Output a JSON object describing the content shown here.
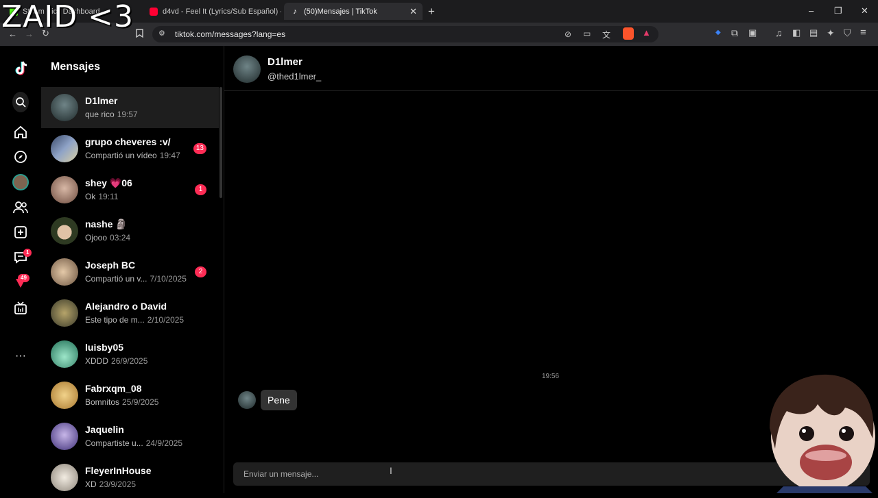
{
  "overlay_text": "ZAID <3",
  "browser": {
    "tabs": [
      {
        "title": "Steam Kick Dashboard",
        "favicon_color": "#53fc18",
        "active": false
      },
      {
        "title": "d4vd - Feel It (Lyrics/Sub Español) - Y",
        "favicon_color": "#ff0033",
        "active": false
      },
      {
        "title": "(50)Mensajes | TikTok",
        "favicon_color": "#111111",
        "active": true
      }
    ],
    "url": "tiktok.com/messages?lang=es",
    "window_controls": {
      "minimize": "–",
      "restore": "❐",
      "close": "✕"
    },
    "new_tab": "+"
  },
  "rail": {
    "notifications_badge": "1",
    "activity_badge": "49"
  },
  "messages": {
    "title": "Mensajes",
    "conversations": [
      {
        "name": "D1lmer",
        "preview": "que rico",
        "time": "19:57",
        "unread": "",
        "avatar": "#3b4d4f",
        "selected": true
      },
      {
        "name": "grupo cheveres :v/",
        "preview": "Compartió un vídeo",
        "time": "19:47",
        "unread": "13",
        "avatar": "#7a8aa8",
        "selected": false
      },
      {
        "name": "shey 💗06",
        "preview": "Ok",
        "time": "19:11",
        "unread": "1",
        "avatar": "#9b7f74",
        "selected": false
      },
      {
        "name": "nashe 🗿",
        "preview": "Ojooo",
        "time": "03:24",
        "unread": "",
        "avatar": "#4e5c3c",
        "selected": false
      },
      {
        "name": "Joseph BC",
        "preview": "Compartió un v...",
        "time": "7/10/2025",
        "unread": "2",
        "avatar": "#8a7562",
        "selected": false
      },
      {
        "name": "Alejandro o David",
        "preview": "Este tipo de m...",
        "time": "2/10/2025",
        "unread": "",
        "avatar": "#5d5a44",
        "selected": false
      },
      {
        "name": "luisby05",
        "preview": "XDDD",
        "time": "26/9/2025",
        "unread": "",
        "avatar": "#2f8f6f",
        "selected": false
      },
      {
        "name": "Fabrxqm_08",
        "preview": "Bomnitos",
        "time": "25/9/2025",
        "unread": "",
        "avatar": "#c79a42",
        "selected": false
      },
      {
        "name": "Jaquelin",
        "preview": "Compartiste u...",
        "time": "24/9/2025",
        "unread": "",
        "avatar": "#6b58a8",
        "selected": false
      },
      {
        "name": "FleyerInHouse",
        "preview": "XD",
        "time": "23/9/2025",
        "unread": "",
        "avatar": "#bbb3a6",
        "selected": false
      }
    ]
  },
  "chat": {
    "name": "D1lmer",
    "handle": "@thed1lmer_",
    "time_label": "19:56",
    "message": "Pene",
    "composer_placeholder": "Enviar un mensaje..."
  }
}
